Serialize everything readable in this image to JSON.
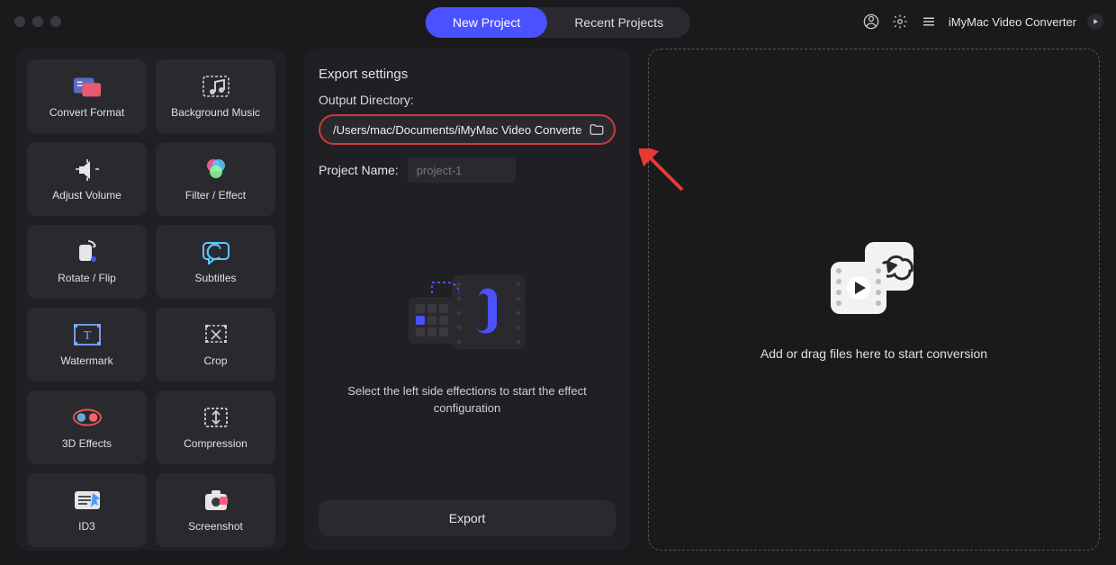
{
  "app": {
    "name": "iMyMac Video Converter"
  },
  "tabs": {
    "new": "New Project",
    "recent": "Recent Projects"
  },
  "sidebar": {
    "tools": [
      {
        "id": "convert-format",
        "label": "Convert Format"
      },
      {
        "id": "background-music",
        "label": "Background Music"
      },
      {
        "id": "adjust-volume",
        "label": "Adjust Volume"
      },
      {
        "id": "filter-effect",
        "label": "Filter / Effect"
      },
      {
        "id": "rotate-flip",
        "label": "Rotate / Flip"
      },
      {
        "id": "subtitles",
        "label": "Subtitles"
      },
      {
        "id": "watermark",
        "label": "Watermark"
      },
      {
        "id": "crop",
        "label": "Crop"
      },
      {
        "id": "3d-effects",
        "label": "3D Effects"
      },
      {
        "id": "compression",
        "label": "Compression"
      },
      {
        "id": "id3",
        "label": "ID3"
      },
      {
        "id": "screenshot",
        "label": "Screenshot"
      }
    ]
  },
  "export": {
    "title": "Export settings",
    "outdir_label": "Output Directory:",
    "outdir_value": "/Users/mac/Documents/iMyMac Video Converte",
    "project_name_label": "Project Name:",
    "project_name_placeholder": "project-1",
    "hint": "Select the left side effections to start the effect configuration",
    "export_button": "Export"
  },
  "drop": {
    "hint": "Add or drag files here to start conversion"
  }
}
